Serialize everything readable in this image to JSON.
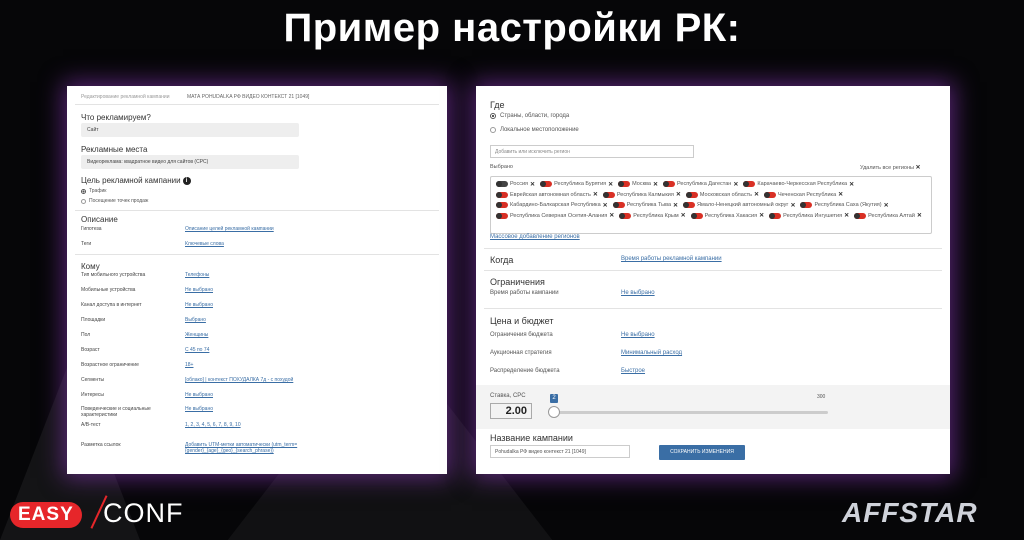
{
  "slide_title": "Пример настройки РК:",
  "left": {
    "breadcrumb": "Редактирование рекламной кампании",
    "campaign_name": "МАТА POHUDALKA РФ ВИДЕО КОНТЕКСТ 21 [1049]",
    "what_label": "Что рекламируем?",
    "what_value": "Сайт",
    "places_label": "Рекламные места",
    "places_value": "Видеорекламa: квадратное видео для сайтов (CPC)",
    "goal_label": "Цель рекламной кампании",
    "goal_options": [
      "Трафик",
      "Посещение точек продаж"
    ],
    "description_heading": "Описание",
    "rows_desc": [
      {
        "label": "Гипотеза",
        "value": "Описание целей рекламной кампании"
      },
      {
        "label": "Теги",
        "value": "Ключевые слова"
      }
    ],
    "whom_heading": "Кому",
    "rows_whom": [
      {
        "label": "Тип мобильного устройства",
        "value": "Телефоны"
      },
      {
        "label": "Мобильные устройства",
        "value": "Не выбрано"
      },
      {
        "label": "Канал доступа в интернет",
        "value": "Не выбрано"
      },
      {
        "label": "Площадки",
        "value": "Выбрано"
      },
      {
        "label": "Пол",
        "value": "Женщины"
      },
      {
        "label": "Возраст",
        "value": "С 45 по 74"
      },
      {
        "label": "Возрастное ограничение",
        "value": "18+"
      },
      {
        "label": "Сегменты",
        "value": "[облако] | контекст ПОХУДАЛКА 7д - с похудой"
      },
      {
        "label": "Интересы",
        "value": "Не выбрано"
      },
      {
        "label": "Поведенческие и социальные характеристики",
        "value": "Не выбрано"
      },
      {
        "label": "A/B-тест",
        "value": "1, 2, 3, 4, 5, 6, 7, 8, 9, 10"
      },
      {
        "label": "Разметка ссылок",
        "value": "Добавить UTM-метки автоматически (utm_term={gender}_{age}_{geo}_{search_phrase})"
      }
    ]
  },
  "right": {
    "where_heading": "Где",
    "where_options": [
      "Страны, области, города",
      "Локальное местоположение"
    ],
    "region_placeholder": "Добавить или исключить регион",
    "selected_label": "Выбрано",
    "remove_all": "Удалить все регионы",
    "regions": [
      "Россия",
      "Республика Бурятия",
      "Москва",
      "Республика Дагестан",
      "Карачаево-Черкесская Республика",
      "Еврейская автономная область",
      "Республика Калмыкия",
      "Московская область",
      "Чеченская Республика",
      "Кабардино-Балкарская Республика",
      "Республика Тыва",
      "Ямало-Ненецкий автономный округ",
      "Республика Саха (Якутия)",
      "Республика Северная Осетия-Алания",
      "Республика Крым",
      "Республика Хакасия",
      "Республика Ингушетия",
      "Республика Алтай"
    ],
    "bulk_add": "Массовое добавление регионов",
    "when_heading": "Когда",
    "when_value": "Время работы рекламной кампании",
    "limits_heading": "Ограничения",
    "limits_row": {
      "label": "Время работы кампании",
      "value": "Не выбрано"
    },
    "price_heading": "Цена и бюджет",
    "price_rows": [
      {
        "label": "Ограничения бюджета",
        "value": "Не выбрано"
      },
      {
        "label": "Аукционная стратегия",
        "value": "Минимальный расход"
      },
      {
        "label": "Распределение бюджета",
        "value": "Быстрое"
      }
    ],
    "bid_label": "Ставка, CPC",
    "bid_value": "2.00",
    "slider_current": "2",
    "slider_max": "300",
    "name_heading": "Название кампании",
    "name_value": "Pohudalka РФ видео контекст 21 [1049]",
    "save_label": "СОХРАНИТЬ ИЗМЕНЕНИЯ"
  },
  "brand_left": {
    "easy": "EASY",
    "conf": "CONF"
  },
  "brand_right": "AFFSTAR"
}
